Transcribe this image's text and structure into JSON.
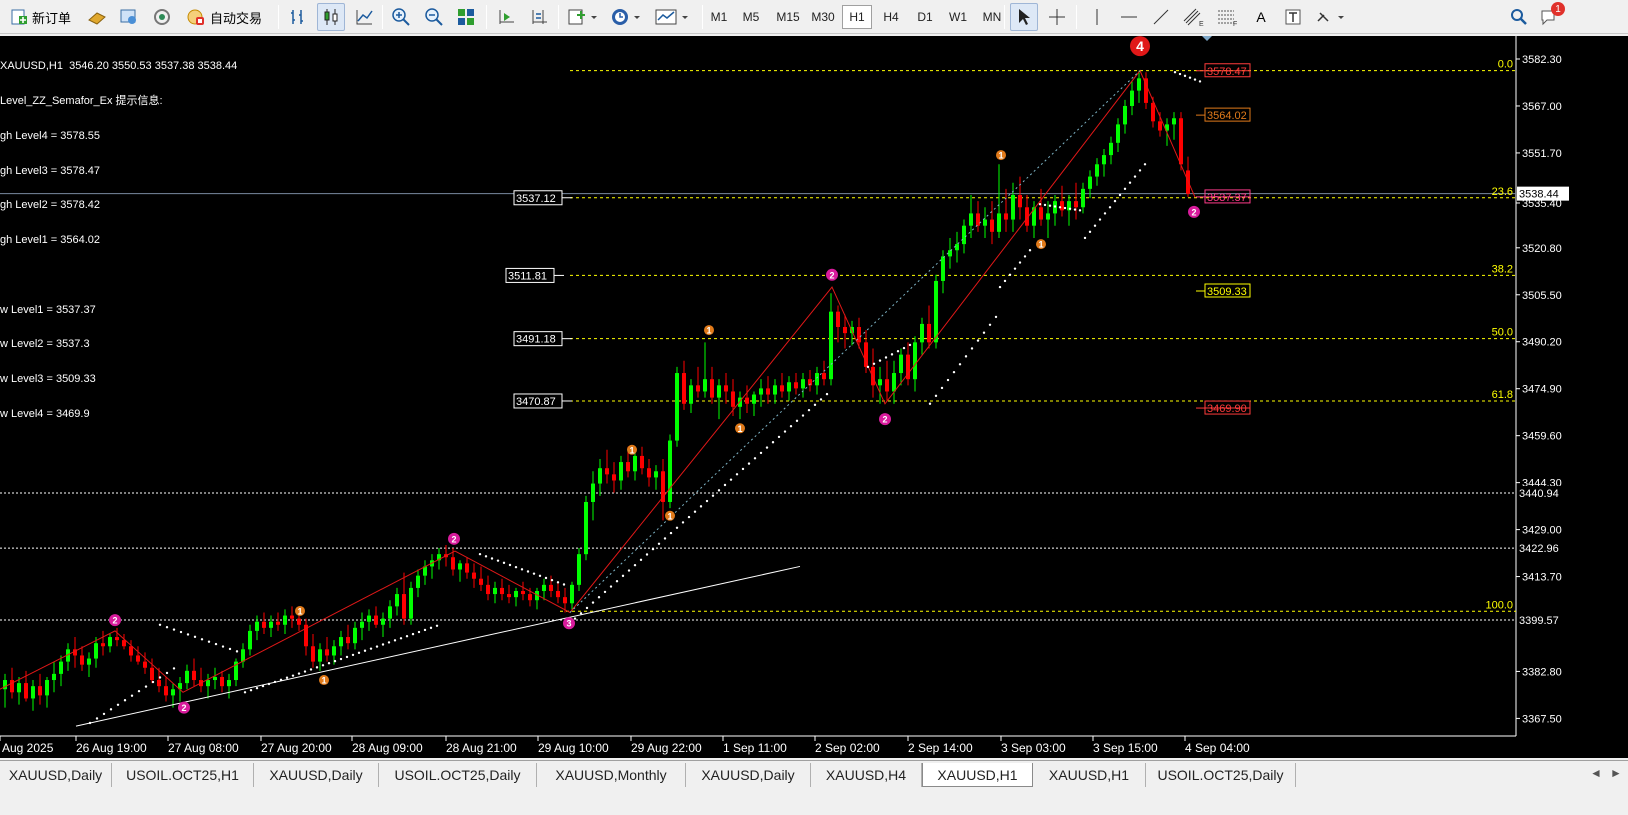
{
  "toolbar": {
    "new_order": "新订单",
    "auto_trading": "自动交易",
    "timeframes": [
      "M1",
      "M5",
      "M15",
      "M30",
      "H1",
      "H4",
      "D1",
      "W1",
      "MN"
    ],
    "active_timeframe": "H1",
    "notification_count": "1",
    "text_tool": "A"
  },
  "chart": {
    "header": "XAUUSD,H1  3546.20 3550.53 3537.38 3538.44",
    "info_lines": [
      "Level_ZZ_Semafor_Ex 提示信息:",
      "gh Level4 = 3578.55",
      "gh Level3 = 3578.47",
      "gh Level2 = 3578.42",
      "gh Level1 = 3564.02",
      "",
      "w Level1 = 3537.37",
      "w Level2 = 3537.3",
      "w Level3 = 3509.33",
      "w Level4 = 3469.9"
    ],
    "price_axis": [
      "3582.30",
      "3567.00",
      "3551.70",
      "3535.40",
      "3520.80",
      "3505.50",
      "3490.20",
      "3474.90",
      "3459.60",
      "3444.30",
      "3429.00",
      "3413.70",
      "3382.80",
      "3367.50"
    ],
    "time_axis": [
      "Aug 2025",
      "26 Aug 19:00",
      "27 Aug 08:00",
      "27 Aug 20:00",
      "28 Aug 09:00",
      "28 Aug 21:00",
      "29 Aug 10:00",
      "29 Aug 22:00",
      "1 Sep 11:00",
      "2 Sep 02:00",
      "2 Sep 14:00",
      "3 Sep 03:00",
      "3 Sep 15:00",
      "4 Sep 04:00"
    ],
    "current_price": "3538.44",
    "hlines": [
      "3440.94",
      "3422.96",
      "3399.57"
    ],
    "fib_levels": [
      "0.0",
      "23.6",
      "38.2",
      "50.0",
      "61.8",
      "100.0"
    ],
    "fib_price_labels": [
      "3537.12",
      "3511.81",
      "3491.18",
      "3470.87"
    ],
    "zz_labels": {
      "high4": "3578.47",
      "high1": "3564.02",
      "low1": "3537.37",
      "low3": "3509.33",
      "low4": "3469.90"
    },
    "semafor_big": "4",
    "colors": {
      "bull": "#00ff00",
      "bear": "#ff0000",
      "fib": "#ffff00",
      "grid": "#ffffff",
      "magenta": "#d81b9c",
      "orange": "#e07a1a"
    }
  },
  "tabs": [
    "XAUUSD,Daily",
    "USOIL.OCT25,H1",
    "XAUUSD,Daily",
    "USOIL.OCT25,Daily",
    "XAUUSD,Monthly",
    "XAUUSD,Daily",
    "XAUUSD,H4",
    "XAUUSD,H1",
    "XAUUSD,H1",
    "USOIL.OCT25,Daily"
  ],
  "active_tab_index": 7,
  "tab_nav": [
    "◄",
    "►"
  ]
}
